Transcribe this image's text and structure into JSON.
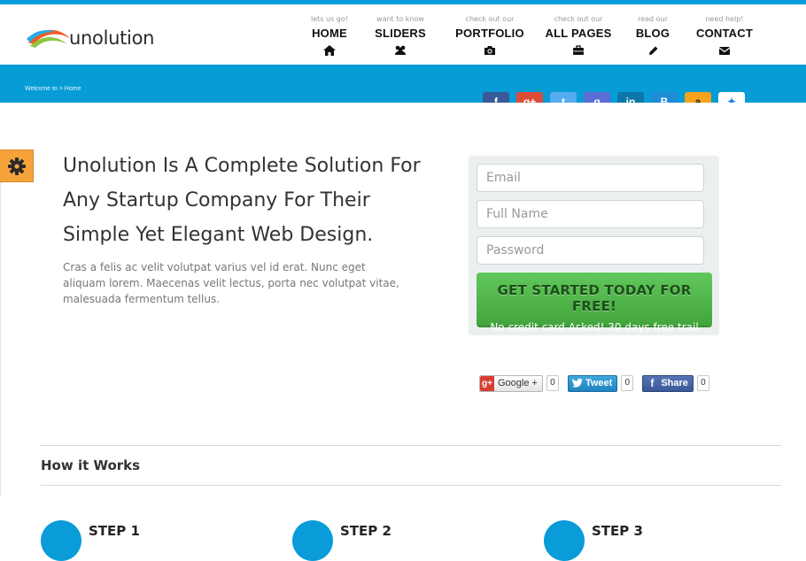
{
  "header": {
    "logo_text": "unolution",
    "nav": [
      {
        "sub": "lets us go!",
        "label": "HOME",
        "icon": "home-icon"
      },
      {
        "sub": "want to know",
        "label": "SLIDERS",
        "icon": "users-icon"
      },
      {
        "sub": "check out our",
        "label": "PORTFOLIO",
        "icon": "camera-icon"
      },
      {
        "sub": "check out our",
        "label": "ALL PAGES",
        "icon": "briefcase-icon"
      },
      {
        "sub": "read our",
        "label": "BLOG",
        "icon": "pencil-icon"
      },
      {
        "sub": "need help!",
        "label": "CONTACT",
        "icon": "envelope-icon"
      }
    ]
  },
  "banner": {
    "breadcrumb": "Welcome to > Home",
    "social": [
      {
        "name": "facebook-icon",
        "glyph": "f",
        "color": "#3b5998"
      },
      {
        "name": "google-plus-icon",
        "glyph": "g+",
        "color": "#dd4b39"
      },
      {
        "name": "twitter-icon",
        "glyph": "t",
        "color": "#55acee"
      },
      {
        "name": "google-icon",
        "glyph": "g",
        "color": "#5b6dd6"
      },
      {
        "name": "linkedin-icon",
        "glyph": "in",
        "color": "#0e76a8"
      },
      {
        "name": "blogger-icon",
        "glyph": "B",
        "color": "#1f8dd6"
      },
      {
        "name": "amazon-icon",
        "glyph": "a",
        "color": "#f7a21b"
      },
      {
        "name": "dropbox-icon",
        "glyph": "✦",
        "color": "#ffffff"
      }
    ]
  },
  "hero": {
    "title": "Unolution Is A Complete Solution For Any Startup Company For Their Simple Yet Elegant Web Design.",
    "description": "Cras a felis ac velit volutpat varius vel id erat. Nunc eget aliquam lorem. Maecenas velit lectus, porta nec volutpat vitae, malesuada fermentum tellus."
  },
  "signup": {
    "email_placeholder": "Email",
    "name_placeholder": "Full Name",
    "password_placeholder": "Password",
    "cta_main": "GET STARTED TODAY FOR FREE!",
    "cta_sub": "No credit card Asked! 30 days free trail"
  },
  "share": {
    "google_label": "Google +",
    "google_badge": "g+",
    "google_count": "0",
    "tweet_label": "Tweet",
    "tweet_count": "0",
    "fb_label": "Share",
    "fb_count": "0"
  },
  "how_it_works": {
    "title": "How it Works",
    "steps": [
      "STEP 1",
      "STEP 2",
      "STEP 3"
    ]
  },
  "colors": {
    "accent": "#049cdb",
    "cta_green": "#4cae46",
    "settings_orange": "#f5a23b"
  }
}
